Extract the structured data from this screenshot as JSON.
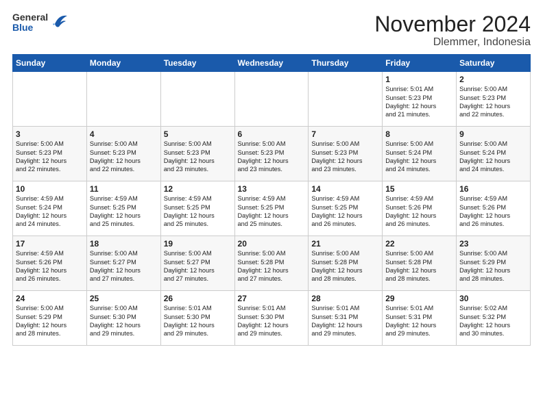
{
  "header": {
    "logo_general": "General",
    "logo_blue": "Blue",
    "title": "November 2024",
    "subtitle": "Dlemmer, Indonesia"
  },
  "days_of_week": [
    "Sunday",
    "Monday",
    "Tuesday",
    "Wednesday",
    "Thursday",
    "Friday",
    "Saturday"
  ],
  "weeks": [
    [
      {
        "day": "",
        "info": ""
      },
      {
        "day": "",
        "info": ""
      },
      {
        "day": "",
        "info": ""
      },
      {
        "day": "",
        "info": ""
      },
      {
        "day": "",
        "info": ""
      },
      {
        "day": "1",
        "info": "Sunrise: 5:01 AM\nSunset: 5:23 PM\nDaylight: 12 hours\nand 21 minutes."
      },
      {
        "day": "2",
        "info": "Sunrise: 5:00 AM\nSunset: 5:23 PM\nDaylight: 12 hours\nand 22 minutes."
      }
    ],
    [
      {
        "day": "3",
        "info": "Sunrise: 5:00 AM\nSunset: 5:23 PM\nDaylight: 12 hours\nand 22 minutes."
      },
      {
        "day": "4",
        "info": "Sunrise: 5:00 AM\nSunset: 5:23 PM\nDaylight: 12 hours\nand 22 minutes."
      },
      {
        "day": "5",
        "info": "Sunrise: 5:00 AM\nSunset: 5:23 PM\nDaylight: 12 hours\nand 23 minutes."
      },
      {
        "day": "6",
        "info": "Sunrise: 5:00 AM\nSunset: 5:23 PM\nDaylight: 12 hours\nand 23 minutes."
      },
      {
        "day": "7",
        "info": "Sunrise: 5:00 AM\nSunset: 5:23 PM\nDaylight: 12 hours\nand 23 minutes."
      },
      {
        "day": "8",
        "info": "Sunrise: 5:00 AM\nSunset: 5:24 PM\nDaylight: 12 hours\nand 24 minutes."
      },
      {
        "day": "9",
        "info": "Sunrise: 5:00 AM\nSunset: 5:24 PM\nDaylight: 12 hours\nand 24 minutes."
      }
    ],
    [
      {
        "day": "10",
        "info": "Sunrise: 4:59 AM\nSunset: 5:24 PM\nDaylight: 12 hours\nand 24 minutes."
      },
      {
        "day": "11",
        "info": "Sunrise: 4:59 AM\nSunset: 5:25 PM\nDaylight: 12 hours\nand 25 minutes."
      },
      {
        "day": "12",
        "info": "Sunrise: 4:59 AM\nSunset: 5:25 PM\nDaylight: 12 hours\nand 25 minutes."
      },
      {
        "day": "13",
        "info": "Sunrise: 4:59 AM\nSunset: 5:25 PM\nDaylight: 12 hours\nand 25 minutes."
      },
      {
        "day": "14",
        "info": "Sunrise: 4:59 AM\nSunset: 5:25 PM\nDaylight: 12 hours\nand 26 minutes."
      },
      {
        "day": "15",
        "info": "Sunrise: 4:59 AM\nSunset: 5:26 PM\nDaylight: 12 hours\nand 26 minutes."
      },
      {
        "day": "16",
        "info": "Sunrise: 4:59 AM\nSunset: 5:26 PM\nDaylight: 12 hours\nand 26 minutes."
      }
    ],
    [
      {
        "day": "17",
        "info": "Sunrise: 4:59 AM\nSunset: 5:26 PM\nDaylight: 12 hours\nand 26 minutes."
      },
      {
        "day": "18",
        "info": "Sunrise: 5:00 AM\nSunset: 5:27 PM\nDaylight: 12 hours\nand 27 minutes."
      },
      {
        "day": "19",
        "info": "Sunrise: 5:00 AM\nSunset: 5:27 PM\nDaylight: 12 hours\nand 27 minutes."
      },
      {
        "day": "20",
        "info": "Sunrise: 5:00 AM\nSunset: 5:28 PM\nDaylight: 12 hours\nand 27 minutes."
      },
      {
        "day": "21",
        "info": "Sunrise: 5:00 AM\nSunset: 5:28 PM\nDaylight: 12 hours\nand 28 minutes."
      },
      {
        "day": "22",
        "info": "Sunrise: 5:00 AM\nSunset: 5:28 PM\nDaylight: 12 hours\nand 28 minutes."
      },
      {
        "day": "23",
        "info": "Sunrise: 5:00 AM\nSunset: 5:29 PM\nDaylight: 12 hours\nand 28 minutes."
      }
    ],
    [
      {
        "day": "24",
        "info": "Sunrise: 5:00 AM\nSunset: 5:29 PM\nDaylight: 12 hours\nand 28 minutes."
      },
      {
        "day": "25",
        "info": "Sunrise: 5:00 AM\nSunset: 5:30 PM\nDaylight: 12 hours\nand 29 minutes."
      },
      {
        "day": "26",
        "info": "Sunrise: 5:01 AM\nSunset: 5:30 PM\nDaylight: 12 hours\nand 29 minutes."
      },
      {
        "day": "27",
        "info": "Sunrise: 5:01 AM\nSunset: 5:30 PM\nDaylight: 12 hours\nand 29 minutes."
      },
      {
        "day": "28",
        "info": "Sunrise: 5:01 AM\nSunset: 5:31 PM\nDaylight: 12 hours\nand 29 minutes."
      },
      {
        "day": "29",
        "info": "Sunrise: 5:01 AM\nSunset: 5:31 PM\nDaylight: 12 hours\nand 29 minutes."
      },
      {
        "day": "30",
        "info": "Sunrise: 5:02 AM\nSunset: 5:32 PM\nDaylight: 12 hours\nand 30 minutes."
      }
    ]
  ]
}
